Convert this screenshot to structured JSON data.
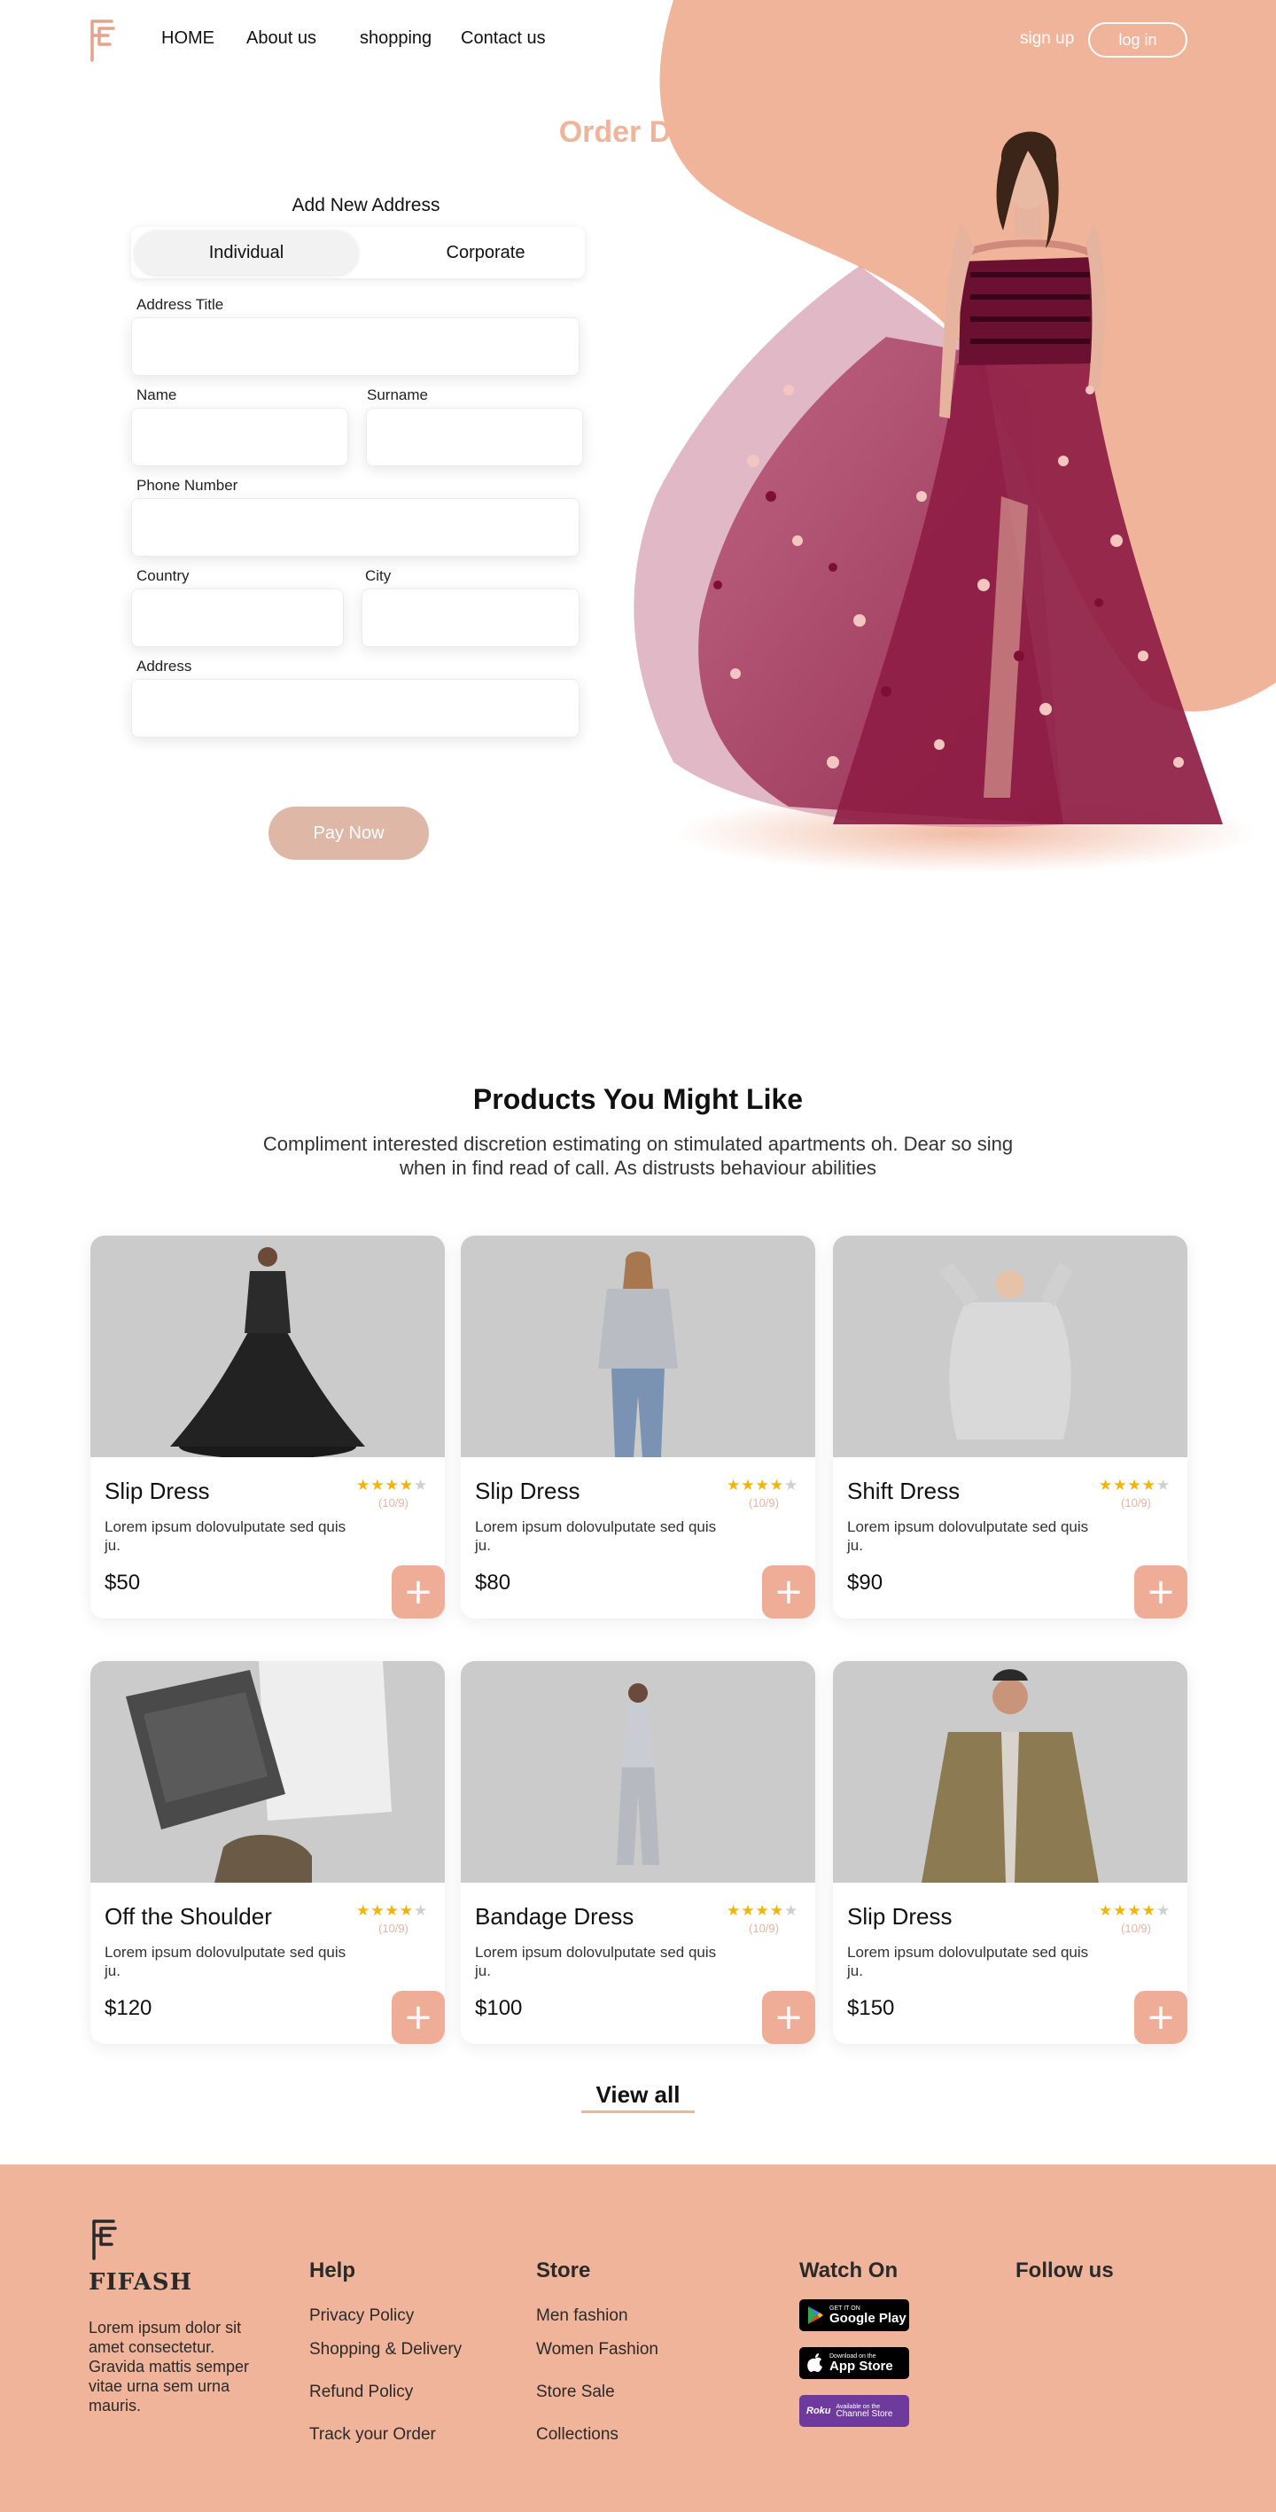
{
  "brand": {
    "name": "FIFASH"
  },
  "nav": {
    "home": "HOME",
    "about": "About us",
    "shopping": "shopping",
    "contact": "Contact us",
    "signup": "sign up",
    "login": "log in"
  },
  "hero": {
    "title": "Order Detail",
    "form_title": "Add New Address",
    "segments": {
      "individual": "Individual",
      "corporate": "Corporate",
      "selected": "Individual"
    },
    "fields": {
      "address_title": {
        "label": "Address Title",
        "value": ""
      },
      "name": {
        "label": "Name",
        "value": ""
      },
      "surname": {
        "label": "Surname",
        "value": ""
      },
      "phone": {
        "label": "Phone Number",
        "value": ""
      },
      "country": {
        "label": "Country",
        "value": ""
      },
      "city": {
        "label": "City",
        "value": ""
      },
      "address": {
        "label": "Address",
        "value": ""
      }
    },
    "pay_button": "Pay Now"
  },
  "products": {
    "title": "Products You Might Like",
    "subtitle": "Compliment interested discretion estimating on stimulated apartments oh. Dear so sing when in find read of call. As distrusts behaviour abilities",
    "items": [
      {
        "name": "Slip Dress",
        "description": "Lorem ipsum dolovulputate sed quis ju.",
        "price": "$50",
        "stars": 4,
        "rating": "(10/9)",
        "image": "black-gown-model"
      },
      {
        "name": "Slip Dress",
        "description": "Lorem ipsum dolovulputate sed quis ju.",
        "price": "$80",
        "stars": 4,
        "rating": "(10/9)",
        "image": "grey-sweater-model"
      },
      {
        "name": "Shift Dress",
        "description": "Lorem ipsum dolovulputate sed quis ju.",
        "price": "$90",
        "stars": 4,
        "rating": "(10/9)",
        "image": "knit-sweater-model"
      },
      {
        "name": "Off the Shoulder",
        "description": "Lorem ipsum dolovulputate sed quis ju.",
        "price": "$120",
        "stars": 4,
        "rating": "(10/9)",
        "image": "folded-jeans-flatlay"
      },
      {
        "name": "Bandage Dress",
        "description": "Lorem ipsum dolovulputate sed quis ju.",
        "price": "$100",
        "stars": 4,
        "rating": "(10/9)",
        "image": "grey-jumpsuit-model"
      },
      {
        "name": "Slip Dress",
        "description": "Lorem ipsum dolovulputate sed quis ju.",
        "price": "$150",
        "stars": 4,
        "rating": "(10/9)",
        "image": "trench-coat-model"
      }
    ],
    "star_glyph": "★",
    "add_glyph": "+",
    "view_all": "View all"
  },
  "footer": {
    "brand": "FIFASH",
    "about": "Lorem ipsum dolor sit amet consectetur. Gravida mattis semper vitae urna sem urna mauris.",
    "help": {
      "title": "Help",
      "links": [
        "Privacy Policy",
        "Shopping & Delivery",
        "Refund Policy",
        "Track your Order"
      ]
    },
    "store": {
      "title": "Store",
      "links": [
        "Men fashion",
        "Women Fashion",
        "Store Sale",
        "Collections"
      ]
    },
    "watch": {
      "title": "Watch On",
      "google_small": "GET IT ON",
      "google_big": "Google Play",
      "apple_small": "Download on the",
      "apple_big": "App Store",
      "roku_word": "Roku",
      "roku_small": "Available on the",
      "roku_big": "Channel Store"
    },
    "follow": {
      "title": "Follow us"
    }
  },
  "colors": {
    "accent": "#efb49a",
    "button_muted": "#dfb7a7",
    "add_button": "#efad97",
    "star": "#f4b400",
    "card_image_bg": "#cbcbcb"
  }
}
